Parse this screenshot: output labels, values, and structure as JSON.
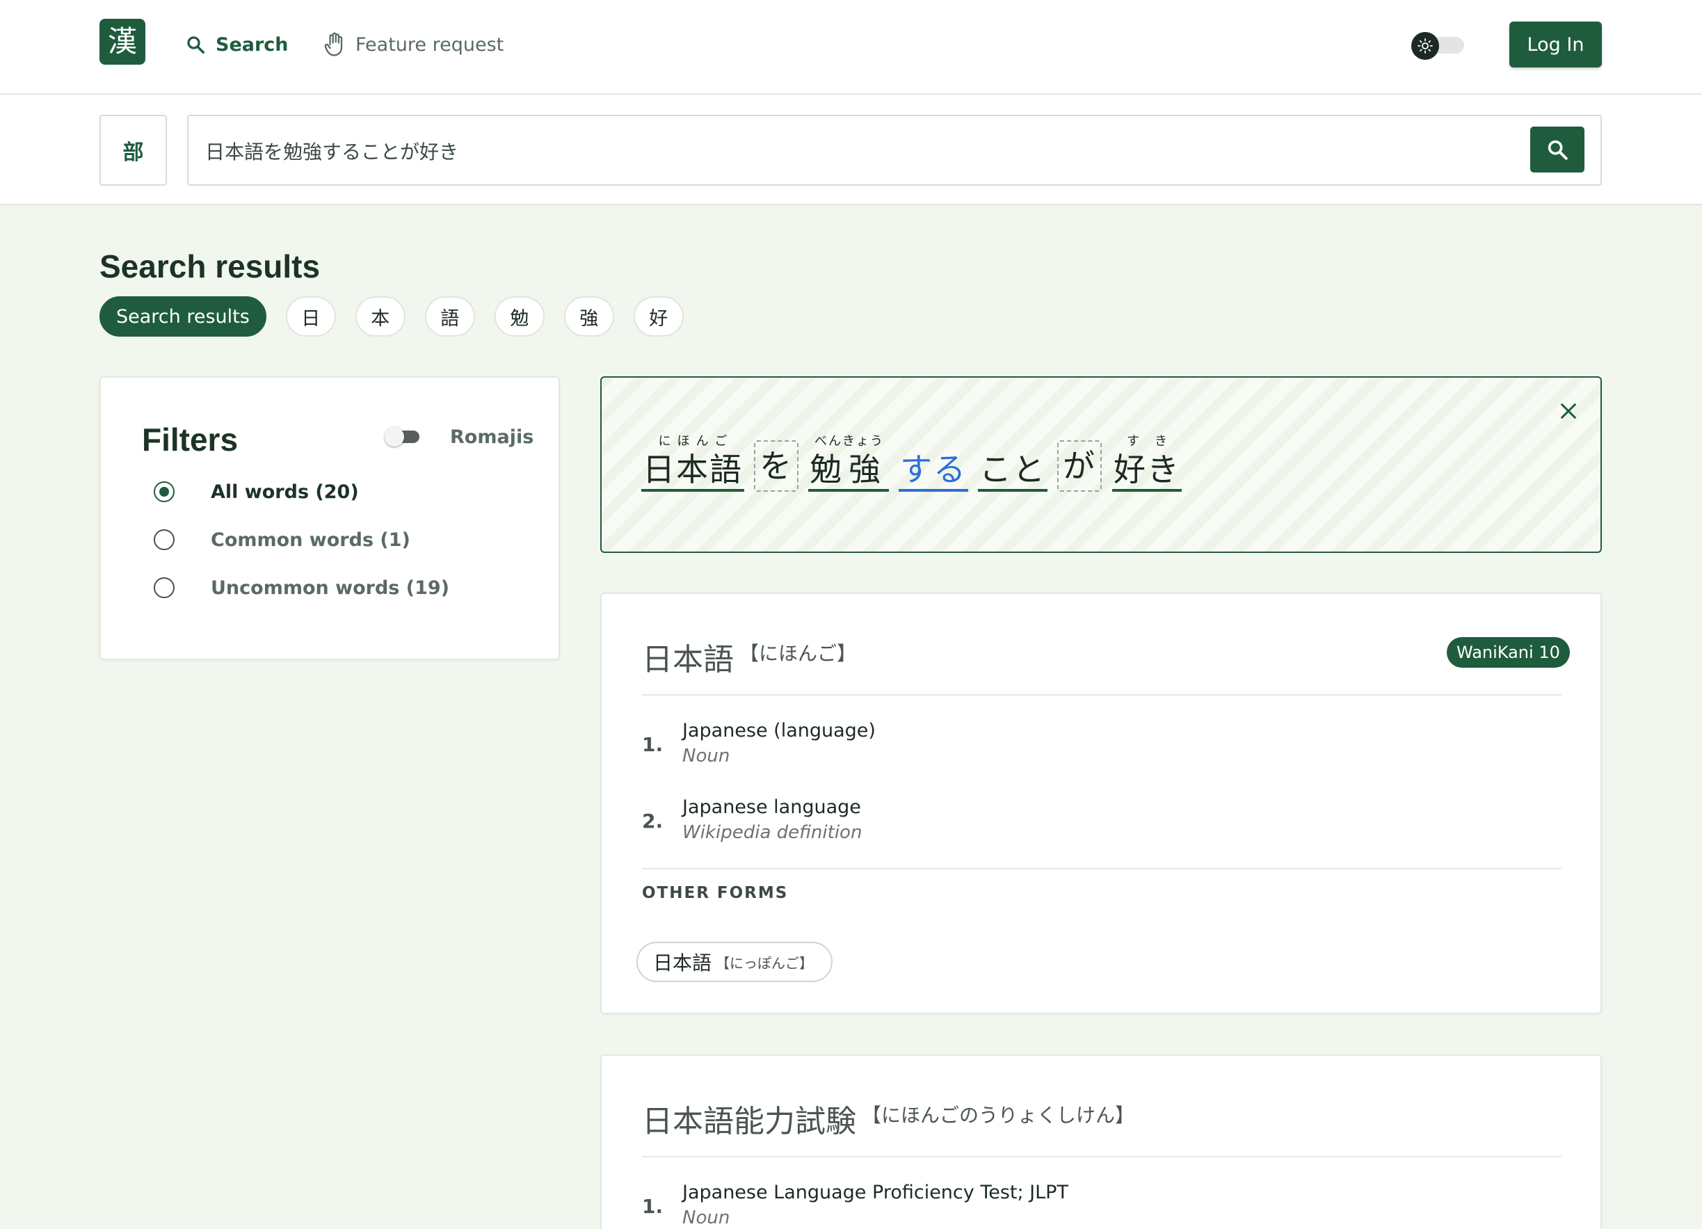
{
  "nav": {
    "logo_char": "漢",
    "search_label": "Search",
    "feature_label": "Feature request",
    "login_label": "Log In"
  },
  "search": {
    "radical_label": "部",
    "query": "日本語を勉強することが好き",
    "placeholder": ""
  },
  "results": {
    "title": "Search results",
    "tabs": [
      {
        "label": "Search results",
        "active": true
      },
      {
        "label": "日"
      },
      {
        "label": "本"
      },
      {
        "label": "語"
      },
      {
        "label": "勉"
      },
      {
        "label": "強"
      },
      {
        "label": "好"
      }
    ]
  },
  "filters": {
    "title": "Filters",
    "romaji_label": "Romajis",
    "romaji_enabled": false,
    "options": [
      {
        "label": "All words (20)",
        "checked": true
      },
      {
        "label": "Common words (1)",
        "checked": false
      },
      {
        "label": "Uncommon words (19)",
        "checked": false
      }
    ]
  },
  "sentence": {
    "tokens": [
      {
        "word": "日本語",
        "furigana": "にほんご",
        "style": "underline"
      },
      {
        "word": "を",
        "furigana": "",
        "style": "particle"
      },
      {
        "word": "勉強",
        "furigana": "べんきょう",
        "style": "underline"
      },
      {
        "word": "する",
        "furigana": "",
        "style": "blue"
      },
      {
        "word": "こと",
        "furigana": "",
        "style": "underline"
      },
      {
        "word": "が",
        "furigana": "",
        "style": "particle"
      },
      {
        "word": "好き",
        "furigana": "すき",
        "style": "underline"
      }
    ]
  },
  "entries": [
    {
      "kanji": "日本語",
      "reading": "【にほんご】",
      "badge": "WaniKani 10",
      "senses": [
        {
          "num": "1.",
          "gloss": "Japanese (language)",
          "pos": "Noun"
        },
        {
          "num": "2.",
          "gloss": "Japanese language",
          "pos": "Wikipedia definition"
        }
      ],
      "other_forms_label": "OTHER FORMS",
      "other_forms": [
        {
          "kanji": "日本語",
          "reading": "【にっぽんご】"
        }
      ]
    },
    {
      "kanji": "日本語能力試験",
      "reading": "【にほんごのうりょくしけん】",
      "senses": [
        {
          "num": "1.",
          "gloss": "Japanese Language Proficiency Test; JLPT",
          "pos": "Noun"
        }
      ]
    }
  ],
  "colors": {
    "brand": "#1f5c3e",
    "page_bg": "#f1f7ee",
    "verb_blue": "#2d6fd8"
  }
}
